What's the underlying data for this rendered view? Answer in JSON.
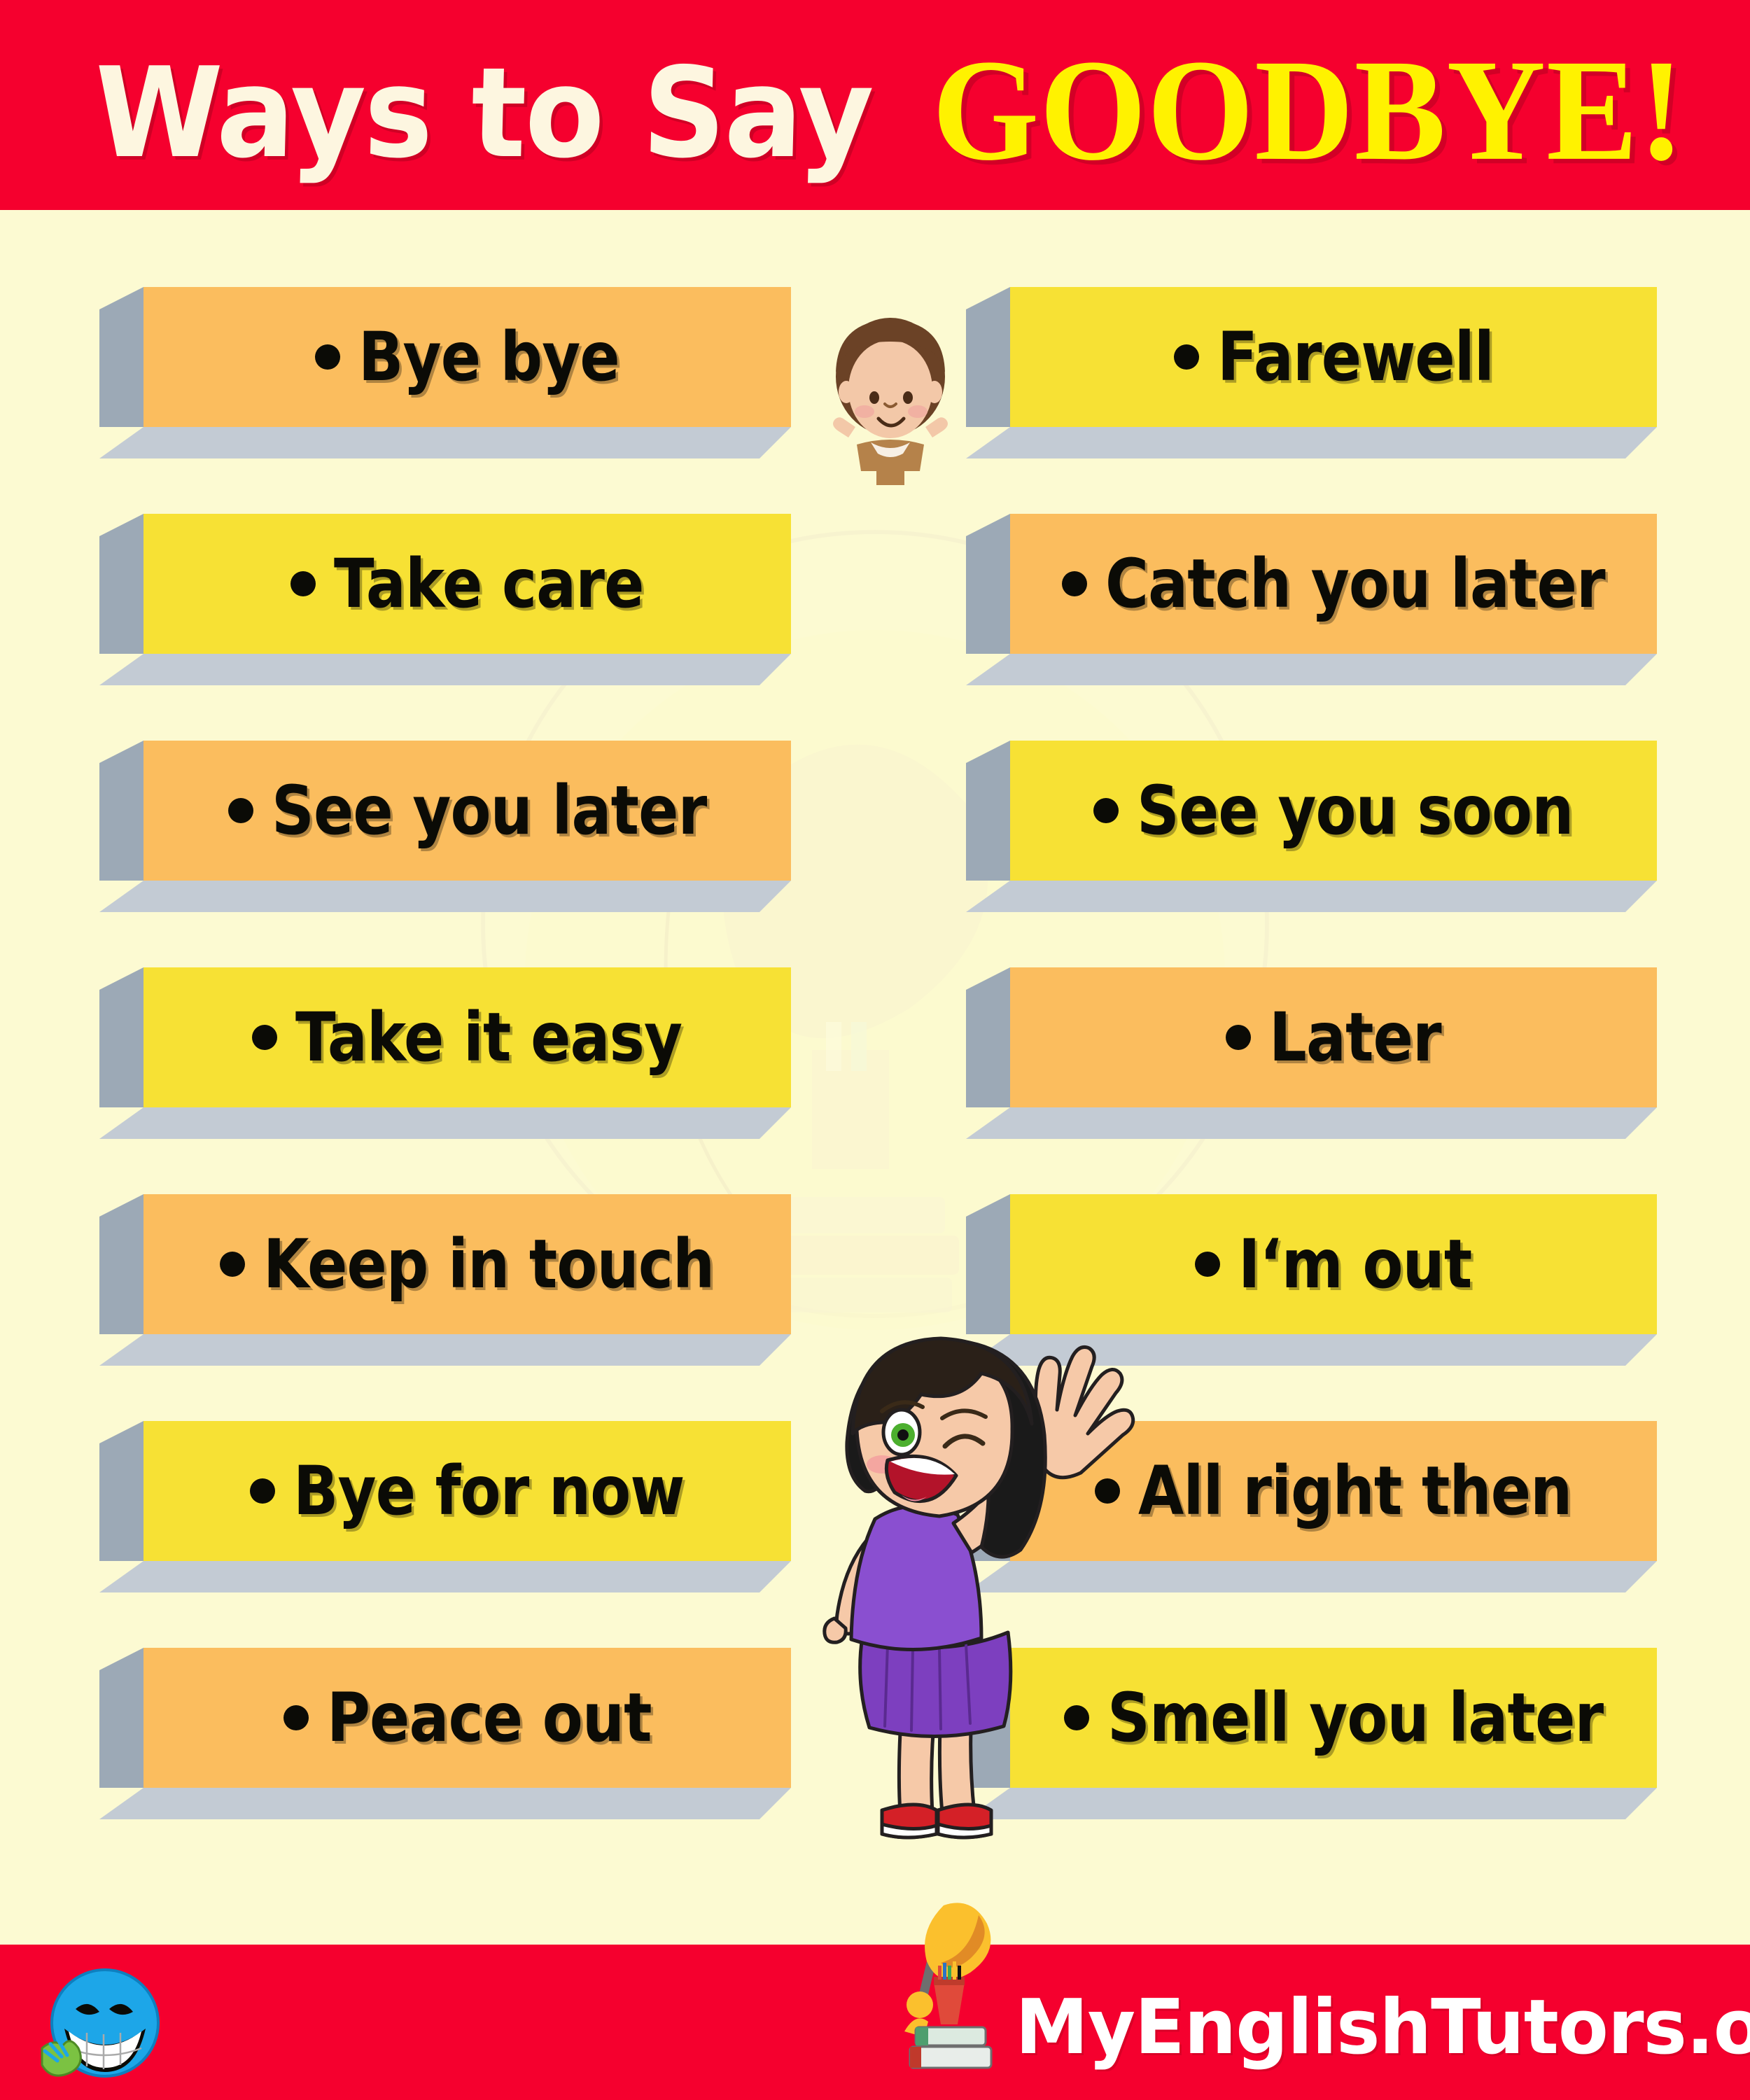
{
  "header": {
    "title_part1": "Ways to Say",
    "title_part2": "GOODBYE!",
    "background_color": "#F5002E",
    "title_part1_color": "#FDF6E0",
    "title_part2_color": "#FFF200"
  },
  "footer": {
    "site_name": "MyEnglishTutors.org",
    "background_color": "#F5002E",
    "text_color": "#FFFFFF",
    "smiley_icon": "blue-smiley-waving-icon",
    "logo_icon": "desk-lamp-books-icon"
  },
  "palette": {
    "page_background": "#FCFAD2",
    "box_orange": "#FBBD5E",
    "box_yellow": "#F7E134",
    "box_side_shadow": "#9CA9B6",
    "box_bottom_shadow": "#C3CBD4",
    "bullet_color": "#0B0B06",
    "text_color": "#0B0B06"
  },
  "illustrations": [
    {
      "name": "boy-waving",
      "description": "cartoon boy with brown hair raising both arms"
    },
    {
      "name": "girl-waving",
      "description": "cartoon girl with black bob hair, purple top and skirt, red shoes, waving one hand"
    }
  ],
  "phrases": {
    "left_column": [
      {
        "text": "Bye bye",
        "color": "orange"
      },
      {
        "text": "Take care",
        "color": "yellow"
      },
      {
        "text": "See you later",
        "color": "orange"
      },
      {
        "text": "Take it easy",
        "color": "yellow"
      },
      {
        "text": "Keep in touch",
        "color": "orange"
      },
      {
        "text": "Bye for now",
        "color": "yellow"
      },
      {
        "text": "Peace out",
        "color": "orange"
      }
    ],
    "right_column": [
      {
        "text": "Farewell",
        "color": "yellow"
      },
      {
        "text": "Catch you later",
        "color": "orange"
      },
      {
        "text": "See you soon",
        "color": "yellow"
      },
      {
        "text": "Later",
        "color": "orange"
      },
      {
        "text": "I‘m out",
        "color": "yellow"
      },
      {
        "text": "All right then",
        "color": "orange"
      },
      {
        "text": "Smell you later",
        "color": "yellow"
      }
    ]
  }
}
